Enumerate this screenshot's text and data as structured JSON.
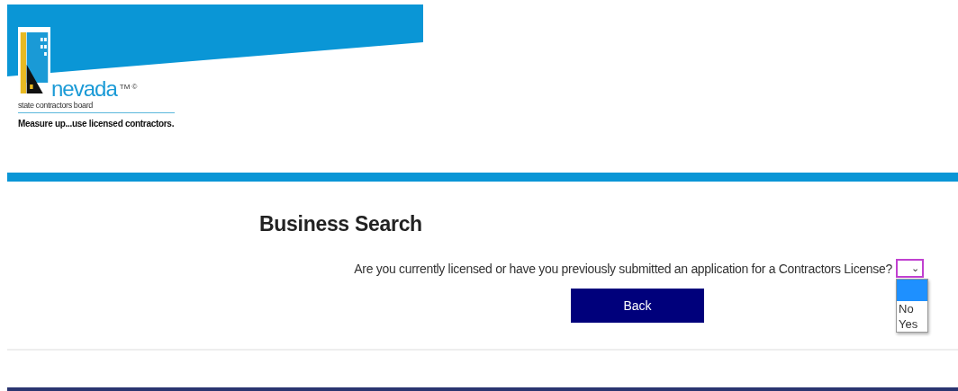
{
  "logo": {
    "name": "nevada",
    "marks": "TM ©",
    "subtitle": "state contractors board",
    "tagline": "Measure up...use licensed contractors."
  },
  "page_title": "Business Search",
  "question": {
    "label": "Are you currently licensed or have you previously submitted an application for a Contractors License?",
    "dropdown": {
      "expanded": true,
      "blank_option_highlighted": true,
      "caret": "⌄",
      "options": [
        {
          "label": "No",
          "selected": false
        },
        {
          "label": "Yes",
          "selected": false
        }
      ]
    }
  },
  "buttons": [
    {
      "label": "Back"
    }
  ]
}
